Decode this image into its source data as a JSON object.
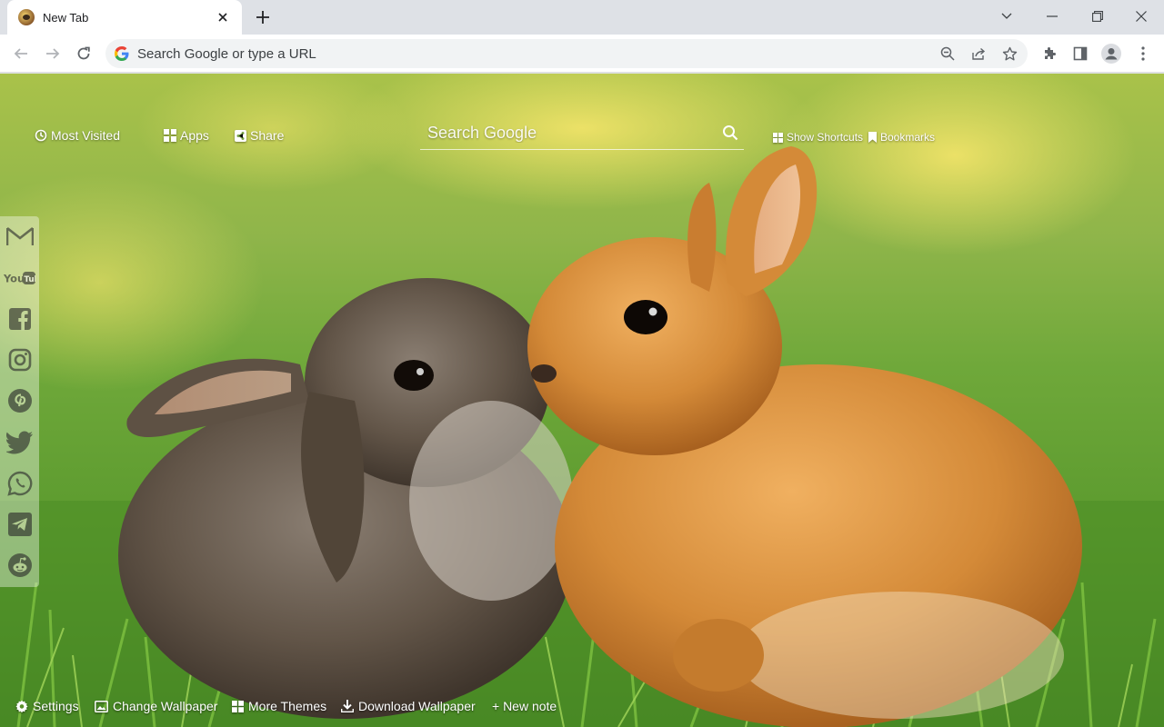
{
  "browser": {
    "tab_title": "New Tab",
    "omnibox_placeholder": "Search Google or type a URL"
  },
  "page": {
    "nav": {
      "most_visited": "Most Visited",
      "apps": "Apps",
      "share": "Share",
      "show_shortcuts": "Show Shortcuts",
      "bookmarks": "Bookmarks"
    },
    "search_placeholder": "Search Google",
    "social_links": [
      "gmail-icon",
      "youtube-icon",
      "facebook-icon",
      "instagram-icon",
      "pinterest-icon",
      "twitter-icon",
      "whatsapp-icon",
      "telegram-icon",
      "reddit-icon"
    ],
    "footer": {
      "settings": "Settings",
      "change_wallpaper": "Change Wallpaper",
      "more_themes": "More Themes",
      "download_wallpaper": "Download Wallpaper",
      "new_note": "+ New note"
    },
    "wallpaper_subject": "two bunnies kissing in grass"
  },
  "colors": {
    "tabstrip_bg": "#dee1e6",
    "omnibox_bg": "#f1f3f4",
    "grass": "#6fa83a",
    "bunny_grey": "#6b5e52",
    "bunny_orange": "#d9913f"
  }
}
